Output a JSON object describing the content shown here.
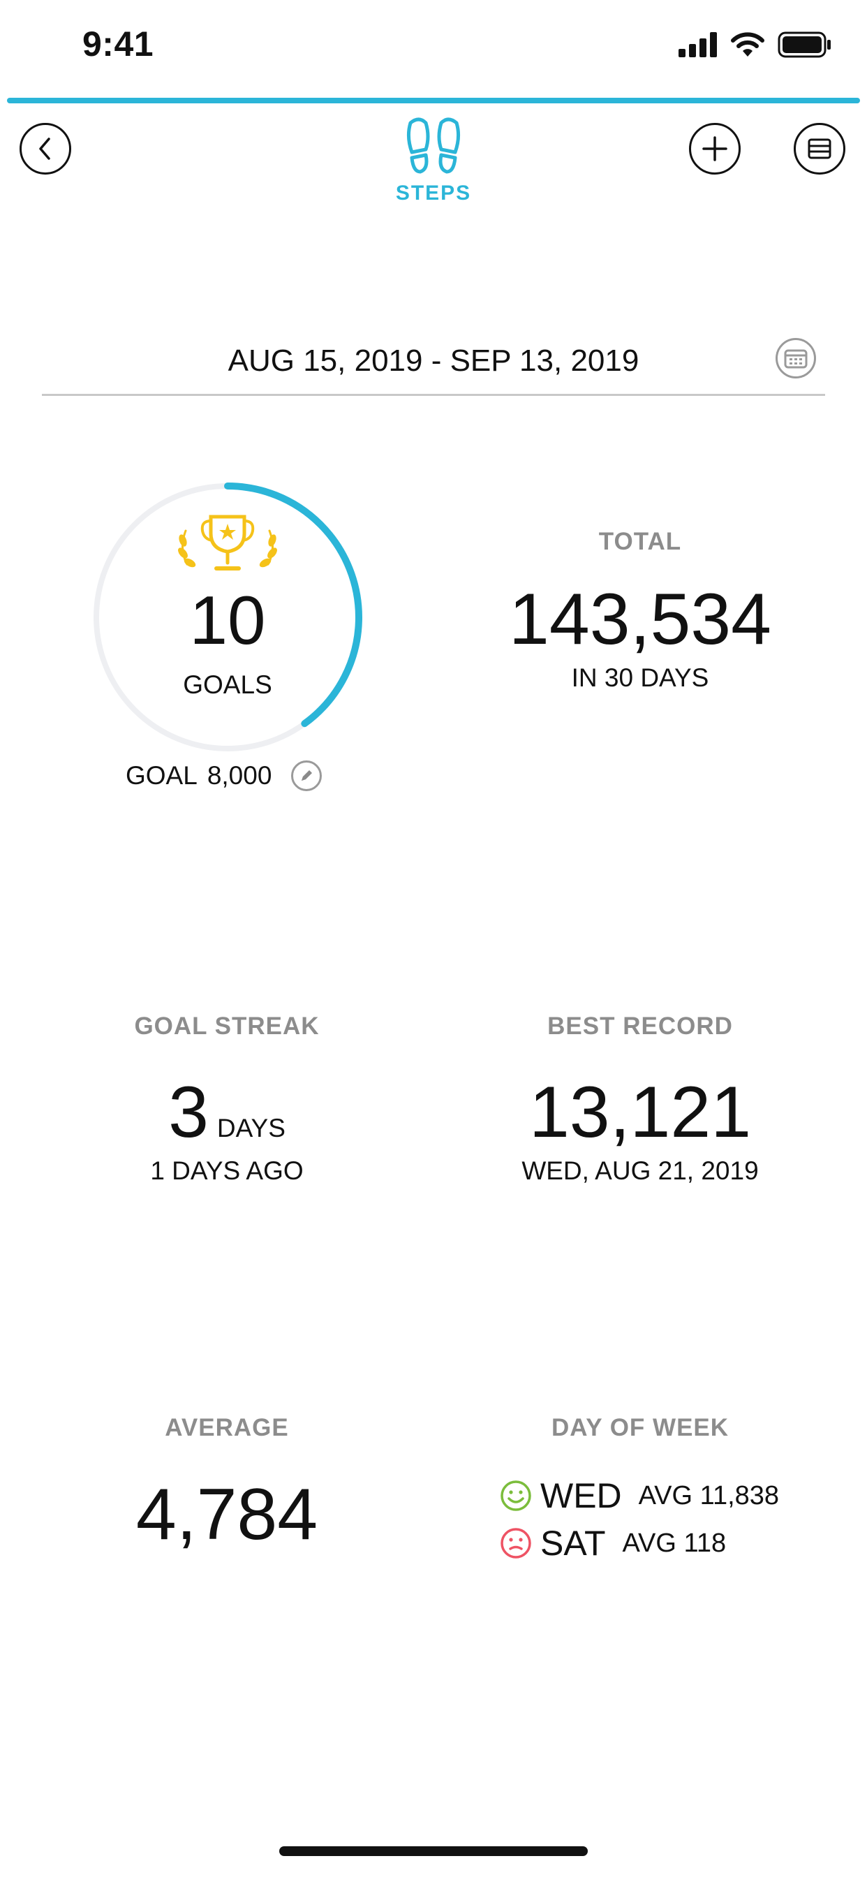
{
  "status_bar": {
    "time": "9:41"
  },
  "colors": {
    "accent": "#2bb5d8",
    "ring_track": "#eeeff2",
    "trophy": "#f5c219",
    "happy": "#7bbd3c",
    "sad": "#ee5364",
    "muted": "#8c8c8c"
  },
  "header": {
    "title": "STEPS",
    "icon": "footsteps-icon",
    "back_icon": "chevron-left-icon",
    "add_icon": "plus-icon",
    "list_icon": "list-view-icon"
  },
  "date_range": {
    "text": "AUG 15, 2019 - SEP 13, 2019",
    "icon": "calendar-icon"
  },
  "goals": {
    "count": "10",
    "label": "GOALS",
    "goal_word": "GOAL",
    "goal_value": "8,000",
    "progress_fraction": 0.4,
    "icon": "trophy-icon"
  },
  "total": {
    "label": "TOTAL",
    "value": "143,534",
    "sub": "IN 30 DAYS"
  },
  "goal_streak": {
    "label": "GOAL STREAK",
    "value": "3",
    "unit": "DAYS",
    "sub": "1 DAYS AGO"
  },
  "best_record": {
    "label": "BEST RECORD",
    "value": "13,121",
    "sub": "WED, AUG 21, 2019"
  },
  "average": {
    "label": "AVERAGE",
    "value": "4,784"
  },
  "day_of_week": {
    "label": "DAY OF WEEK",
    "best": {
      "day": "WED",
      "avg": "AVG 11,838",
      "icon": "smiley-happy-icon"
    },
    "worst": {
      "day": "SAT",
      "avg": "AVG 118",
      "icon": "smiley-sad-icon"
    }
  }
}
